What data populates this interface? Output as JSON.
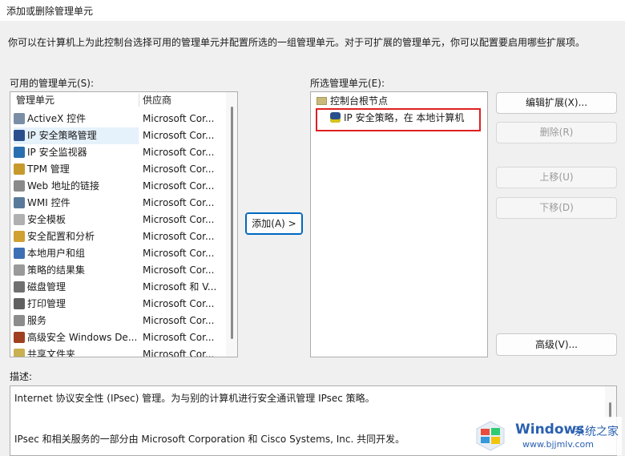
{
  "window": {
    "title": "添加或删除管理单元"
  },
  "intro_text": "你可以在计算机上为此控制台选择可用的管理单元并配置所选的一组管理单元。对于可扩展的管理单元，你可以配置要启用哪些扩展项。",
  "available": {
    "label": "可用的管理单元(S):",
    "headers": {
      "name": "管理单元",
      "vendor": "供应商"
    },
    "items": [
      {
        "name": "ActiveX 控件",
        "vendor": "Microsoft Cor...",
        "icon": "activex-icon",
        "color": "#7a8fa6"
      },
      {
        "name": "IP 安全策略管理",
        "vendor": "Microsoft Cor...",
        "icon": "ip-security-policy-icon",
        "color": "#2a4f8c",
        "selected": true
      },
      {
        "name": "IP 安全监视器",
        "vendor": "Microsoft Cor...",
        "icon": "ip-security-monitor-icon",
        "color": "#2a6fb0"
      },
      {
        "name": "TPM 管理",
        "vendor": "Microsoft Cor...",
        "icon": "tpm-icon",
        "color": "#c79a2c"
      },
      {
        "name": "Web 地址的链接",
        "vendor": "Microsoft Cor...",
        "icon": "web-link-icon",
        "color": "#8a8a8a"
      },
      {
        "name": "WMI 控件",
        "vendor": "Microsoft Cor...",
        "icon": "wmi-icon",
        "color": "#5a7a9a"
      },
      {
        "name": "安全模板",
        "vendor": "Microsoft Cor...",
        "icon": "security-template-icon",
        "color": "#b0b0b0"
      },
      {
        "name": "安全配置和分析",
        "vendor": "Microsoft Cor...",
        "icon": "security-analysis-icon",
        "color": "#d0a030"
      },
      {
        "name": "本地用户和组",
        "vendor": "Microsoft Cor...",
        "icon": "users-groups-icon",
        "color": "#3c6fb4"
      },
      {
        "name": "策略的结果集",
        "vendor": "Microsoft Cor...",
        "icon": "policy-result-icon",
        "color": "#9a9a9a"
      },
      {
        "name": "磁盘管理",
        "vendor": "Microsoft 和 V...",
        "icon": "disk-icon",
        "color": "#707070"
      },
      {
        "name": "打印管理",
        "vendor": "Microsoft Cor...",
        "icon": "printer-icon",
        "color": "#606060"
      },
      {
        "name": "服务",
        "vendor": "Microsoft Cor...",
        "icon": "services-icon",
        "color": "#8c8c8c"
      },
      {
        "name": "高级安全 Windows De...",
        "vendor": "Microsoft Cor...",
        "icon": "firewall-icon",
        "color": "#a04020"
      },
      {
        "name": "共享文件夹",
        "vendor": "Microsoft Cor...",
        "icon": "shared-folder-icon",
        "color": "#c9b050"
      }
    ]
  },
  "add_button": "添加(A) >",
  "selected": {
    "label": "所选管理单元(E):",
    "root": "控制台根节点",
    "child": "IP 安全策略，在 本地计算机"
  },
  "buttons": {
    "edit_ext": "编辑扩展(X)...",
    "remove": "删除(R)",
    "move_up": "上移(U)",
    "move_down": "下移(D)",
    "advanced": "高级(V)..."
  },
  "description": {
    "label": "描述:",
    "line1": "Internet 协议安全性 (IPsec) 管理。为与别的计算机进行安全通讯管理 IPsec 策略。",
    "line2": "IPsec 和相关服务的一部分由 Microsoft Corporation 和 Cisco Systems, Inc. 共同开发。"
  },
  "watermark": {
    "brand": "Windows",
    "tagline": "系统之家",
    "url": "www.bjjmlv.com"
  },
  "colors": {
    "accent": "#0067c0",
    "highlight": "#e02020",
    "selection": "#e5f1fb"
  }
}
